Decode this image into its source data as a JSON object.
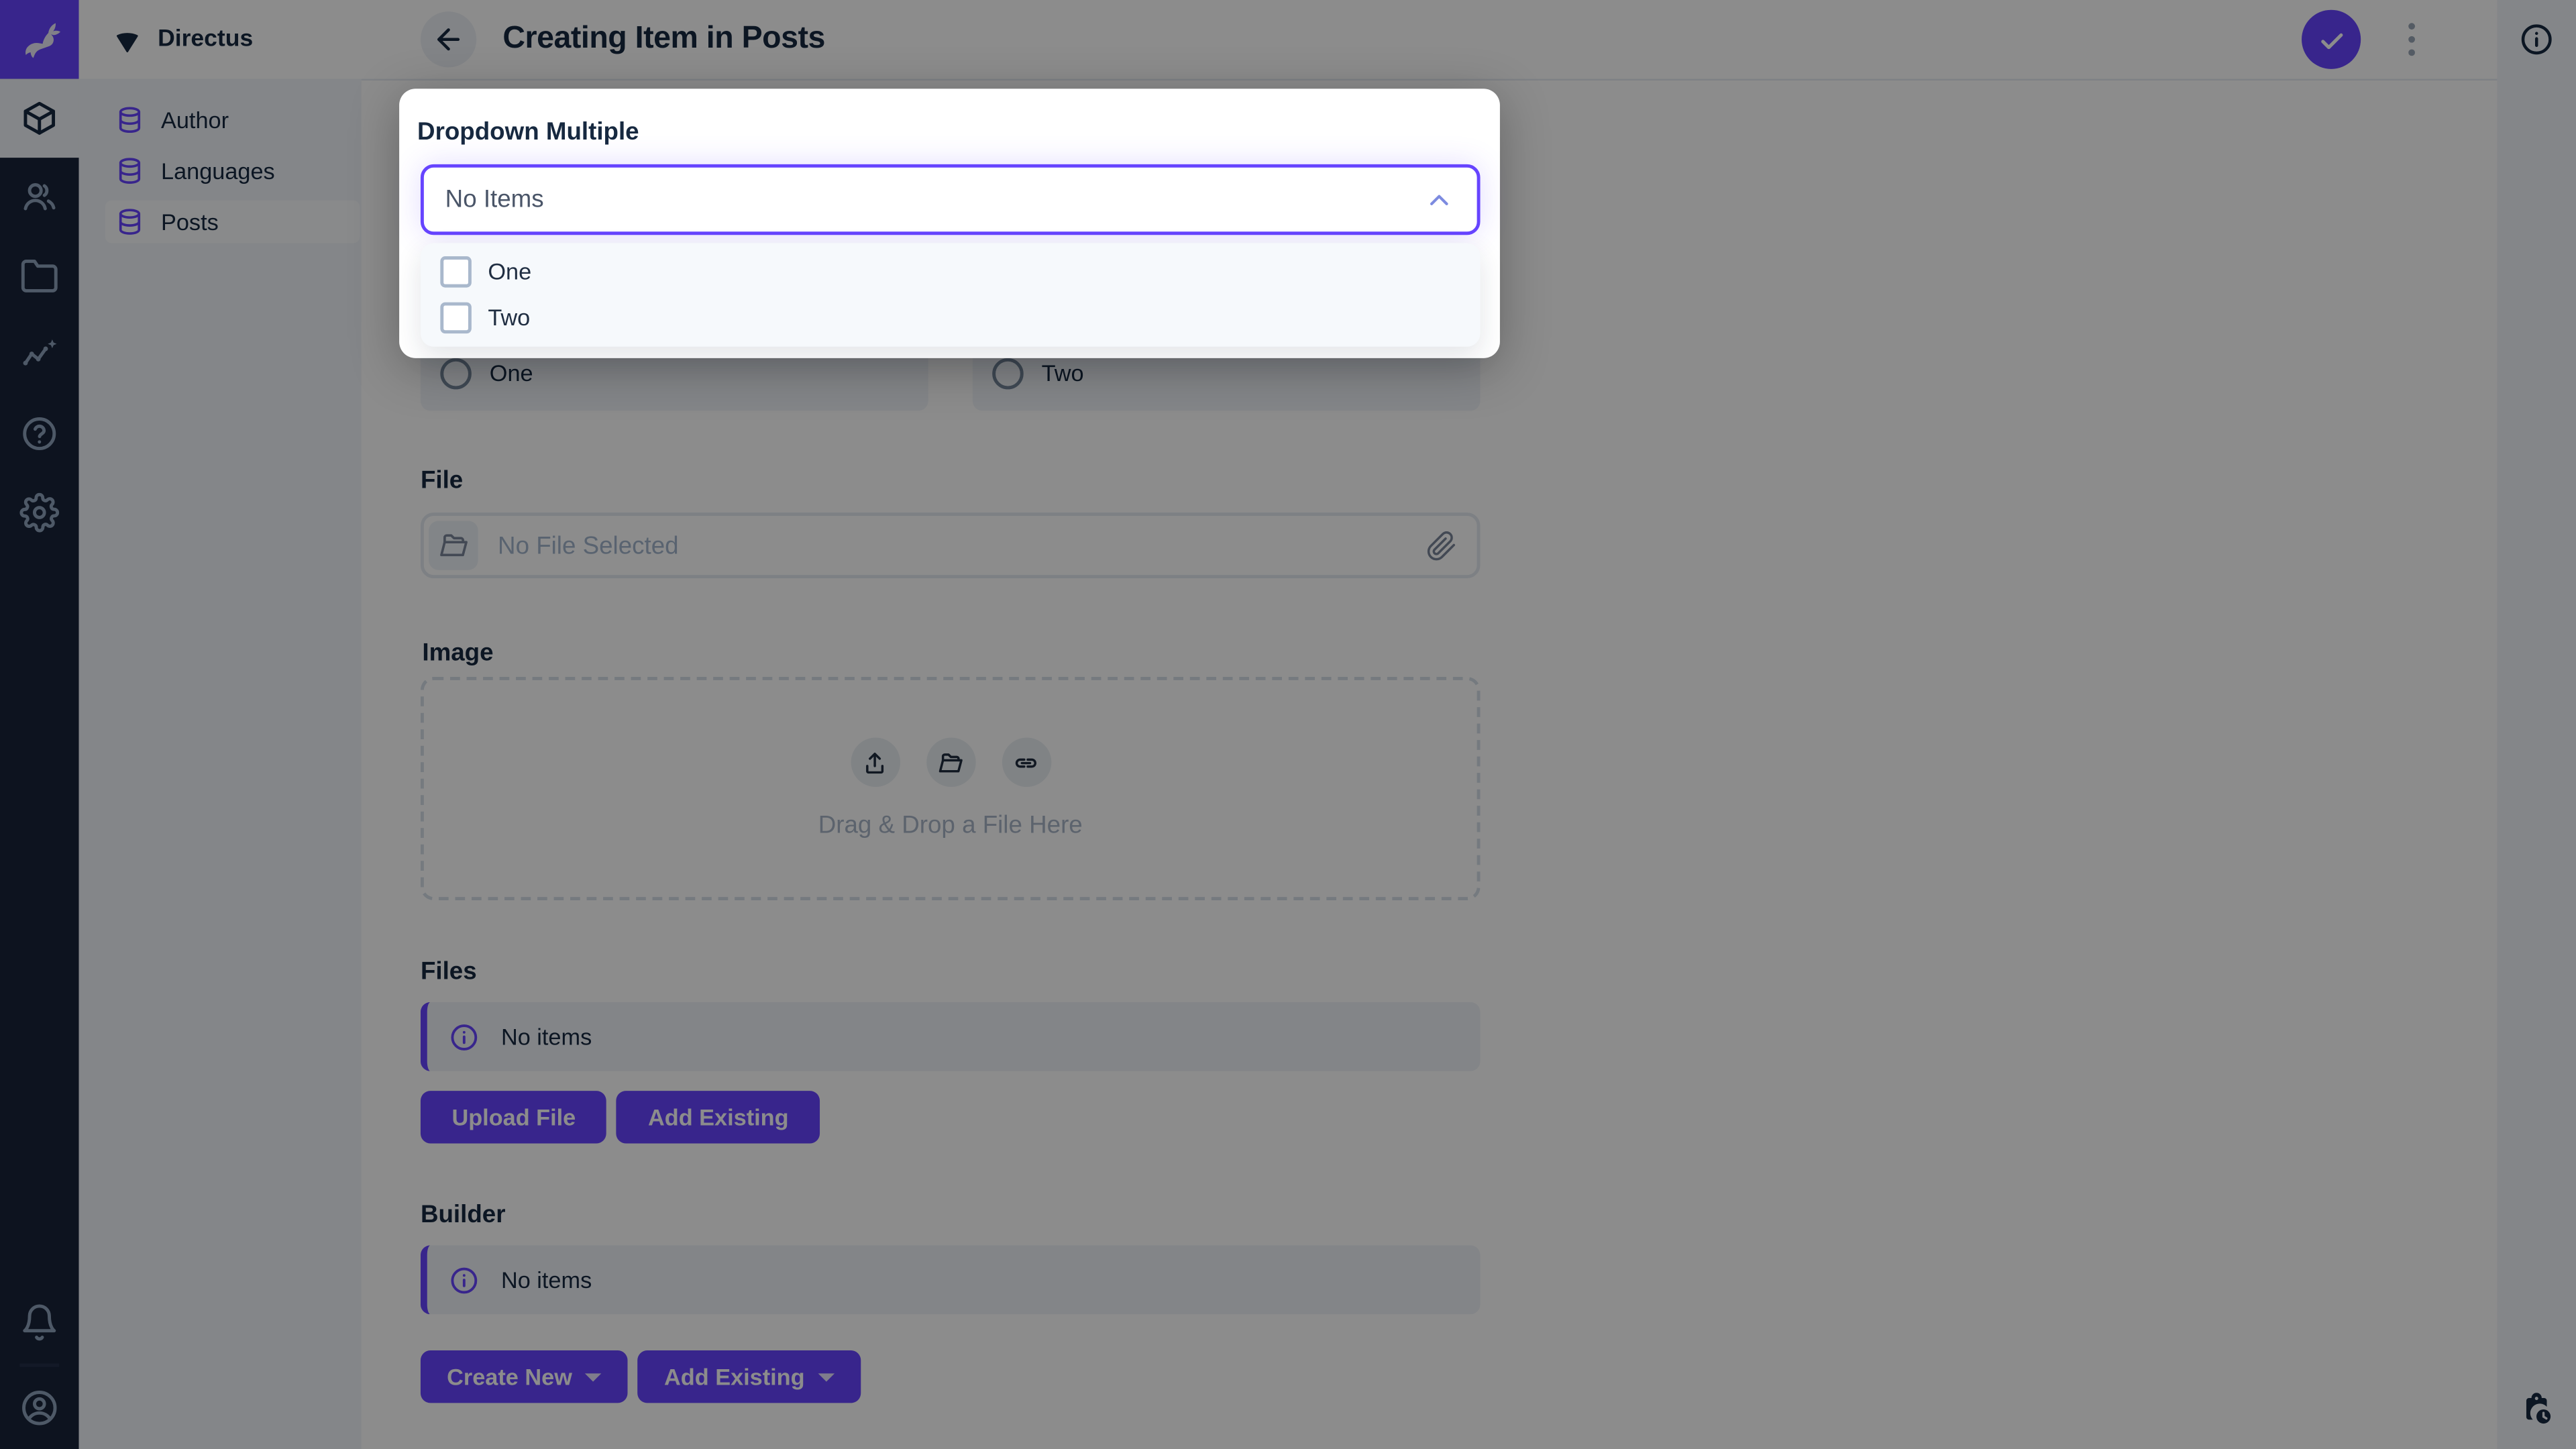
{
  "colors": {
    "brand_purple": "#6644FF",
    "module_bar_bg": "#18243A",
    "sidebar_bg": "#F0F4F9",
    "text_dark": "#172940",
    "overlay": "rgba(0,0,0,0.45)"
  },
  "brand": {
    "project_name": "Directus"
  },
  "module_bar": {
    "items": [
      {
        "name": "content",
        "icon": "box-icon",
        "active": true
      },
      {
        "name": "user-directory",
        "icon": "users-icon",
        "active": false
      },
      {
        "name": "file-library",
        "icon": "folder-icon",
        "active": false
      },
      {
        "name": "insights",
        "icon": "insights-icon",
        "active": false
      },
      {
        "name": "help",
        "icon": "help-icon",
        "active": false
      },
      {
        "name": "settings",
        "icon": "gear-icon",
        "active": false
      }
    ],
    "bottom": [
      {
        "name": "notifications",
        "icon": "bell-icon"
      },
      {
        "name": "account",
        "icon": "account-circle-icon"
      }
    ]
  },
  "nav": {
    "items": [
      {
        "label": "Author",
        "icon": "database-icon",
        "active": false
      },
      {
        "label": "Languages",
        "icon": "database-icon",
        "active": false
      },
      {
        "label": "Posts",
        "icon": "database-icon",
        "active": true
      }
    ]
  },
  "header": {
    "title": "Creating Item in Posts"
  },
  "dropdown_modal": {
    "label": "Dropdown Multiple",
    "value": "No Items",
    "options": [
      {
        "label": "One",
        "checked": false
      },
      {
        "label": "Two",
        "checked": false
      }
    ]
  },
  "radio_field": {
    "options": [
      {
        "label": "One"
      },
      {
        "label": "Two"
      }
    ]
  },
  "file_field": {
    "label": "File",
    "placeholder": "No File Selected"
  },
  "image_field": {
    "label": "Image",
    "dropzone_text": "Drag & Drop a File Here"
  },
  "files_field": {
    "label": "Files",
    "notice": "No items",
    "upload_button": "Upload File",
    "add_button": "Add Existing"
  },
  "builder_field": {
    "label": "Builder",
    "notice": "No items",
    "create_button": "Create New",
    "add_button": "Add Existing"
  }
}
